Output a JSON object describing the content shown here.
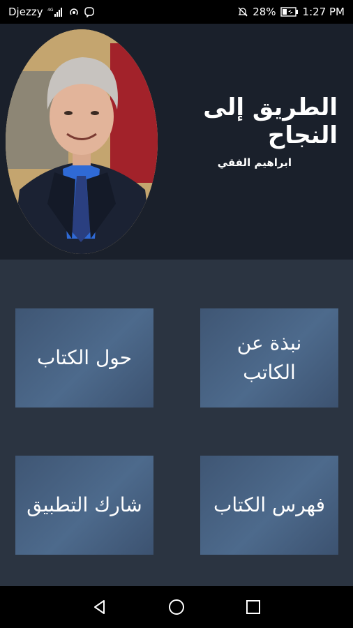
{
  "status_bar": {
    "carrier": "Djezzy",
    "network_type": "4G",
    "battery_percent": "28%",
    "time": "1:27 PM"
  },
  "header": {
    "title": "الطريق إلى النجاح",
    "author": "ابراهيم الفقي"
  },
  "menu": {
    "about_book": "حول الكتاب",
    "about_author_line1": "نبذة عن",
    "about_author_line2": "الكاتب",
    "share_app": "شارك التطبيق",
    "book_index": "فهرس الكتاب"
  },
  "colors": {
    "header_bg": "#1a202b",
    "content_bg": "#2b3441",
    "tile_bg": "#46607f"
  }
}
